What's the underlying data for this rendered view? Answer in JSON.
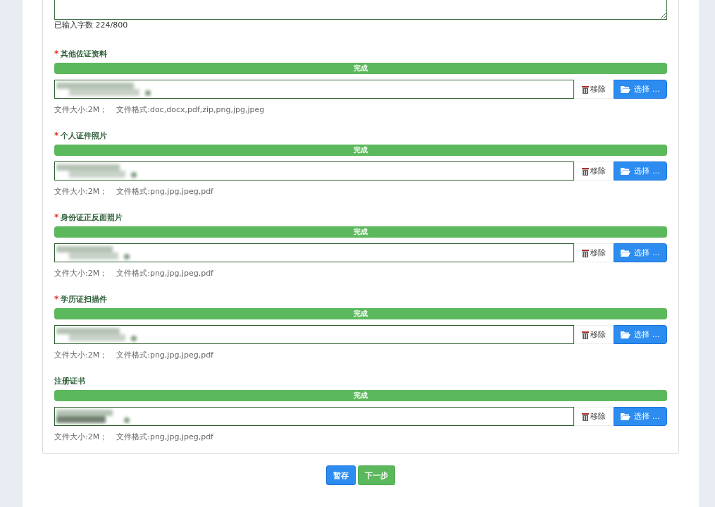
{
  "textarea": {
    "counter": "已输入字数 224/800"
  },
  "uploads": [
    {
      "label": "其他佐证资料",
      "asterisk": "*",
      "level": 1,
      "status": "完成",
      "remove": "移除",
      "choose": "选择 …",
      "size": "文件大小:2M；",
      "formats": "文件格式:doc,docx,pdf,zip,png,jpg,jpeg"
    },
    {
      "label": "个人证件照片",
      "asterisk": "*",
      "level": 1,
      "status": "完成",
      "remove": "移除",
      "choose": "选择 …",
      "size": "文件大小:2M；",
      "formats": "文件格式:png,jpg,jpeg,pdf"
    },
    {
      "label": "身份证正反面照片",
      "asterisk": "*",
      "level": 1,
      "status": "完成",
      "remove": "移除",
      "choose": "选择 …",
      "size": "文件大小:2M；",
      "formats": "文件格式:png,jpg,jpeg,pdf"
    },
    {
      "label": "学历证扫描件",
      "asterisk": "*",
      "level": 1,
      "status": "完成",
      "remove": "移除",
      "choose": "选择 …",
      "size": "文件大小:2M；",
      "formats": "文件格式:png,jpg,jpeg,pdf"
    },
    {
      "label": "注册证书",
      "level": 1,
      "status": "完成",
      "remove": "移除",
      "choose": "选择 …",
      "size": "文件大小:2M；",
      "formats": "文件格式:png,jpg,jpeg,pdf"
    }
  ],
  "buttons": [
    {
      "label": "暂存",
      "kind": "primary"
    },
    {
      "label": "下一步",
      "kind": "success"
    }
  ]
}
